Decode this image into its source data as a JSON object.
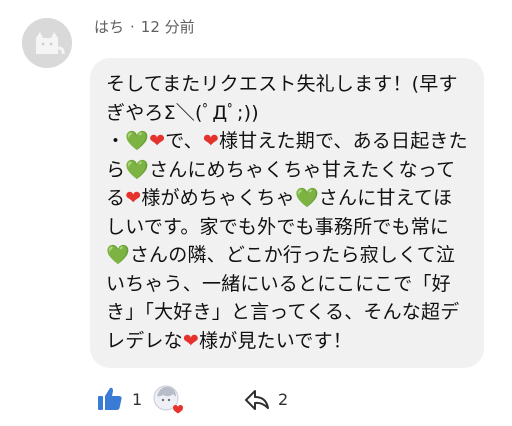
{
  "comment": {
    "author": "はち",
    "separator": "·",
    "time": "12 分前",
    "message_segments": [
      {
        "t": "text",
        "v": "そしてまたリクエスト失礼します！(早すぎやろΣ＼(ﾟДﾟ;))\n・"
      },
      {
        "t": "green_heart",
        "v": "💚"
      },
      {
        "t": "red_heart",
        "v": "❤"
      },
      {
        "t": "text",
        "v": "で、"
      },
      {
        "t": "red_heart",
        "v": "❤"
      },
      {
        "t": "text",
        "v": "様甘えた期で、ある日起きたら"
      },
      {
        "t": "green_heart",
        "v": "💚"
      },
      {
        "t": "text",
        "v": "さんにめちゃくちゃ甘えたくなってる"
      },
      {
        "t": "red_heart",
        "v": "❤"
      },
      {
        "t": "text",
        "v": "様がめちゃくちゃ"
      },
      {
        "t": "green_heart",
        "v": "💚"
      },
      {
        "t": "text",
        "v": "さんに甘えてほしいです。家でも外でも事務所でも常に"
      },
      {
        "t": "green_heart",
        "v": "💚"
      },
      {
        "t": "text",
        "v": "さんの隣、どこか行ったら寂しくて泣いちゃう、一緒にいるとにこにこで「好き」「大好き」と言ってくる、そんな超デレデレな"
      },
      {
        "t": "red_heart",
        "v": "❤"
      },
      {
        "t": "text",
        "v": "様が見たいです！"
      }
    ]
  },
  "actions": {
    "like_count": "1",
    "reply_count": "2",
    "like_icon": "thumbs-up-icon",
    "reply_icon": "reply-arrow-icon"
  },
  "colors": {
    "bubble_bg": "#f1f1f1",
    "like_blue": "#3a7bd5",
    "red_heart": "#e5322d",
    "green_heart": "#1aa63a"
  }
}
